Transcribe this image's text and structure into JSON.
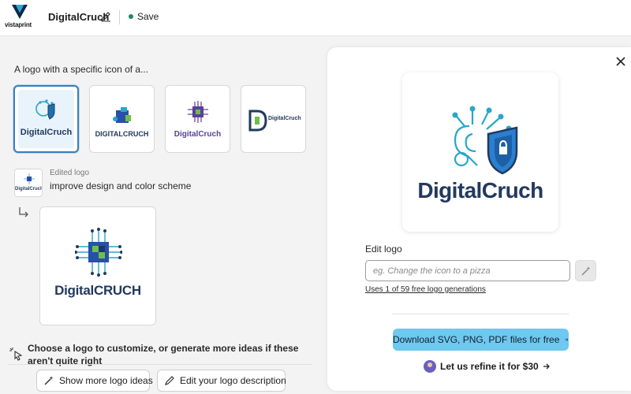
{
  "topbar": {
    "brand_name": "vistaprint",
    "project_title": "DigitalCruch",
    "save_label": "Save",
    "status_color": "#1b8a5a"
  },
  "left": {
    "heading": "A logo with a specific icon of a...",
    "logo_options": [
      {
        "text": "DigitalCruch",
        "selected": true
      },
      {
        "text": "DIGITALCRUCH",
        "selected": false
      },
      {
        "text": "DigitalCruch",
        "selected": false
      },
      {
        "text": "DigitalCruch",
        "selected": false
      }
    ],
    "history": {
      "label": "Edited logo",
      "description": "improve design and color scheme",
      "thumb_text": "DigitalCruch",
      "result_text": "DigitalCRUCH"
    },
    "hint": "Choose a logo to customize, or generate more ideas if these aren't quite right",
    "show_more_label": "Show more logo ideas",
    "edit_description_label": "Edit your logo description"
  },
  "right": {
    "preview_text": "DigitalCruch",
    "edit_label": "Edit logo",
    "edit_placeholder": "eg. Change the icon to a pizza",
    "usage_text": "Uses 1 of 59 free logo generations",
    "download_label": "Download SVG, PNG, PDF files for free",
    "refine_label": "Let us refine it for $30"
  },
  "icons": [
    "brand-logo-icon",
    "pencil-icon",
    "close-icon",
    "magic-wand-icon",
    "arrow-right-icon",
    "return-arrow-icon",
    "cursor-sparkle-icon"
  ],
  "colors": {
    "accent_blue": "#6ec8ef",
    "selected_border": "#3a7fbf",
    "navy": "#223a5e",
    "teal": "#2aa6c9",
    "green": "#6cc04a"
  }
}
